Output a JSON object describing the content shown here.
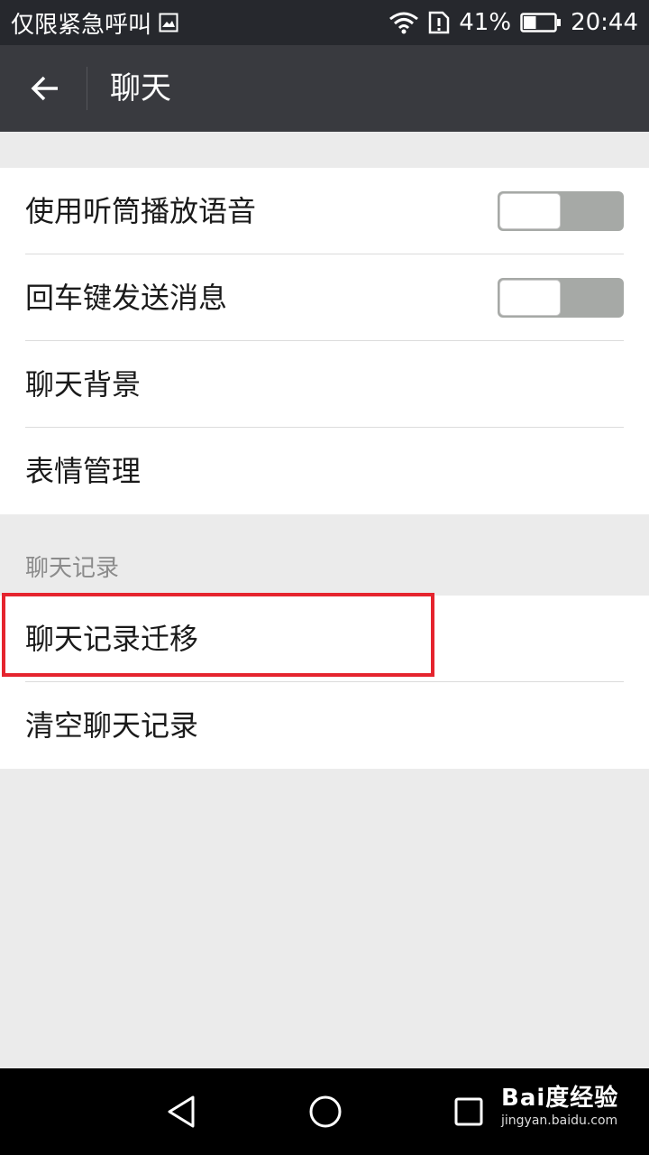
{
  "status_bar": {
    "carrier": "仅限紧急呼叫",
    "battery_percent": "41%",
    "time": "20:44",
    "battery_level": 0.41,
    "icons": [
      "image-icon",
      "wifi-icon",
      "sim-alert-icon",
      "battery-icon"
    ]
  },
  "app_bar": {
    "title": "聊天",
    "back_icon": "arrow-left-icon"
  },
  "settings": {
    "general": [
      {
        "label": "使用听筒播放语音",
        "toggle": false
      },
      {
        "label": "回车键发送消息",
        "toggle": false
      },
      {
        "label": "聊天背景"
      },
      {
        "label": "表情管理"
      }
    ],
    "history_header": "聊天记录",
    "history": [
      {
        "label": "聊天记录迁移"
      },
      {
        "label": "清空聊天记录"
      }
    ]
  },
  "nav_bar": {
    "icons": [
      "back-triangle-icon",
      "home-circle-icon",
      "recents-square-icon"
    ]
  },
  "watermark": {
    "brand": "Bai度经验",
    "url": "jingyan.baidu.com"
  },
  "colors": {
    "status_bar": "#26282d",
    "app_bar": "#393a3f",
    "background": "#ebebeb",
    "toggle_track": "#a6a9a6",
    "highlight": "#e5242e"
  }
}
